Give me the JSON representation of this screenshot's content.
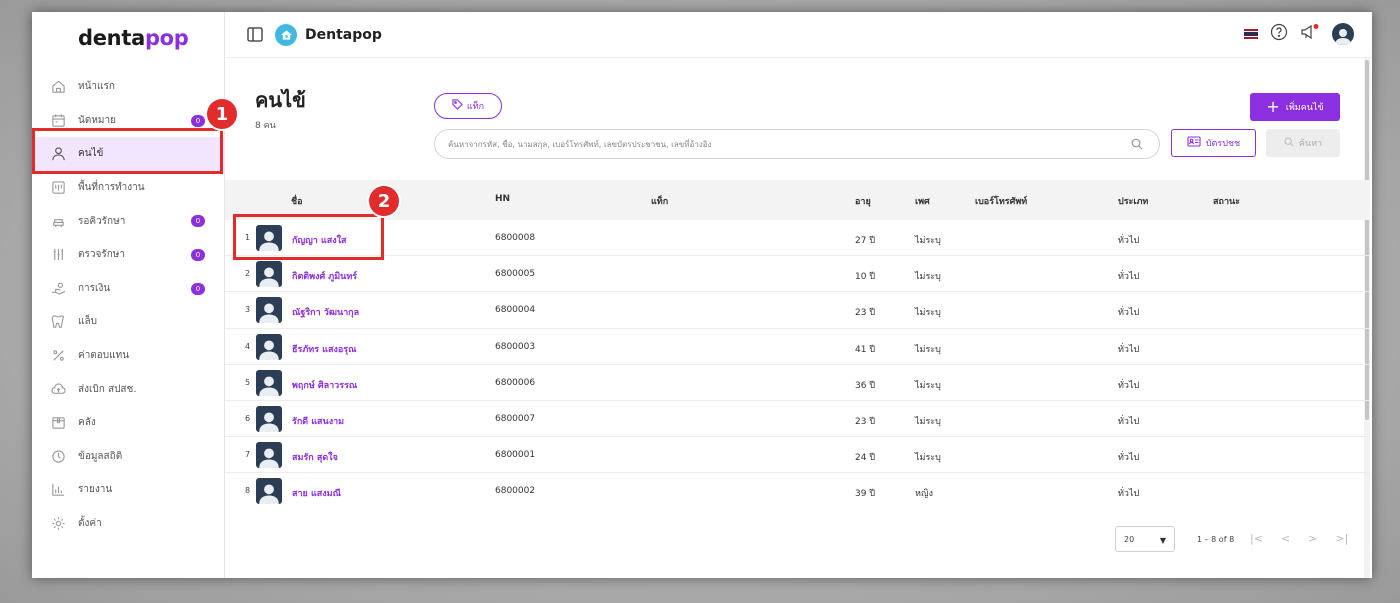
{
  "app": {
    "logo_main": "denta",
    "logo_accent": "pop",
    "brand": "Dentapop",
    "accent_color": "#8b2fe0"
  },
  "sidebar": {
    "items": [
      {
        "label": "หน้าแรก",
        "icon": "home-icon",
        "badge": null
      },
      {
        "label": "นัดหมาย",
        "icon": "calendar-icon",
        "badge": "0"
      },
      {
        "label": "คนไข้",
        "icon": "person-icon",
        "badge": null,
        "active": true
      },
      {
        "label": "พื้นที่การทำงาน",
        "icon": "workspace-icon",
        "badge": null
      },
      {
        "label": "รอคิวรักษา",
        "icon": "dental-chair-icon",
        "badge": "0"
      },
      {
        "label": "ตรวจรักษา",
        "icon": "dental-tools-icon",
        "badge": "0"
      },
      {
        "label": "การเงิน",
        "icon": "money-hand-icon",
        "badge": "0"
      },
      {
        "label": "แล็บ",
        "icon": "tooth-icon",
        "badge": null
      },
      {
        "label": "ค่าตอบแทน",
        "icon": "percent-icon",
        "badge": null
      },
      {
        "label": "ส่งเบิก สปสช.",
        "icon": "cloud-upload-icon",
        "badge": null
      },
      {
        "label": "คลัง",
        "icon": "box-icon",
        "badge": null
      },
      {
        "label": "ข้อมูลสถิติ",
        "icon": "stats-icon",
        "badge": null
      },
      {
        "label": "รายงาน",
        "icon": "bar-chart-icon",
        "badge": null
      },
      {
        "label": "ตั้งค่า",
        "icon": "gear-icon",
        "badge": null
      }
    ]
  },
  "page": {
    "title": "คนไข้",
    "count": "8 คน",
    "tag_button": "แท็ก",
    "add_button": "เพิ่มคนไข้",
    "search_placeholder": "ค้นหาจากรหัส, ชื่อ, นามสกุล, เบอร์โทรศัพท์, เลขบัตรประชาชน, เลขที่อ้างอิง",
    "idcard_button": "บัตรปชช",
    "search_button": "ค้นหา"
  },
  "table": {
    "headers": {
      "name": "ชื่อ",
      "hn": "HN",
      "tag": "แท็ก",
      "age": "อายุ",
      "sex": "เพศ",
      "phone": "เบอร์โทรศัพท์",
      "type": "ประเภท",
      "status": "สถานะ"
    },
    "rows": [
      {
        "idx": "1",
        "name": "กัญญา แสงใส",
        "hn": "6800008",
        "age": "27 ปี",
        "sex": "ไม่ระบุ",
        "type": "ทั่วไป"
      },
      {
        "idx": "2",
        "name": "กิตติพงศ์ ภูมินทร์",
        "hn": "6800005",
        "age": "10 ปี",
        "sex": "ไม่ระบุ",
        "type": "ทั่วไป"
      },
      {
        "idx": "3",
        "name": "ณัฐริกา วัฒนากุล",
        "hn": "6800004",
        "age": "23 ปี",
        "sex": "ไม่ระบุ",
        "type": "ทั่วไป"
      },
      {
        "idx": "4",
        "name": "ธีรภัทร แสงอรุณ",
        "hn": "6800003",
        "age": "41 ปี",
        "sex": "ไม่ระบุ",
        "type": "ทั่วไป"
      },
      {
        "idx": "5",
        "name": "พฤกษ์ ศิลาวรรณ",
        "hn": "6800006",
        "age": "36 ปี",
        "sex": "ไม่ระบุ",
        "type": "ทั่วไป"
      },
      {
        "idx": "6",
        "name": "รักดี แสนงาม",
        "hn": "6800007",
        "age": "23 ปี",
        "sex": "ไม่ระบุ",
        "type": "ทั่วไป"
      },
      {
        "idx": "7",
        "name": "สมรัก สุดใจ",
        "hn": "6800001",
        "age": "24 ปี",
        "sex": "ไม่ระบุ",
        "type": "ทั่วไป"
      },
      {
        "idx": "8",
        "name": "สาย แสงมณี",
        "hn": "6800002",
        "age": "39 ปี",
        "sex": "หญิง",
        "type": "ทั่วไป"
      }
    ]
  },
  "pagination": {
    "per_page": "20",
    "range": "1 – 8 of 8"
  },
  "annotations": {
    "step1": "1",
    "step2": "2",
    "color": "#e22b2b"
  }
}
